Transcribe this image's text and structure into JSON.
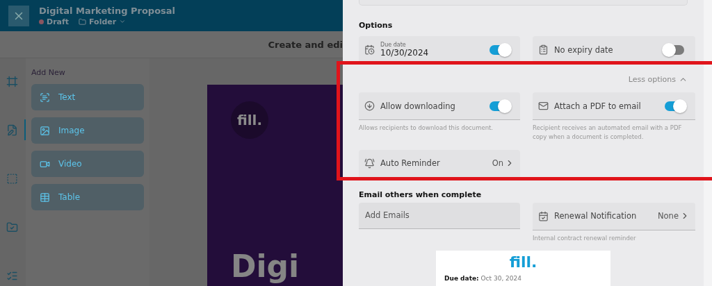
{
  "header": {
    "title": "Digital Marketing Proposal",
    "status": "Draft",
    "folder": "Folder"
  },
  "toolbar_text": "Create and edi",
  "rail": [
    {
      "kind": "frame",
      "selected": false
    },
    {
      "kind": "document",
      "selected": true
    },
    {
      "kind": "dots",
      "selected": false
    },
    {
      "kind": "folder",
      "selected": false
    },
    {
      "kind": "checklist",
      "selected": false
    }
  ],
  "add_new": {
    "title": "Add New",
    "items": [
      {
        "kind": "text",
        "label": "Text"
      },
      {
        "kind": "image",
        "label": "Image"
      },
      {
        "kind": "video",
        "label": "Video"
      },
      {
        "kind": "table",
        "label": "Table"
      }
    ]
  },
  "canvas": {
    "logo": "fill.",
    "headline": "Digi"
  },
  "options": {
    "heading": "Options",
    "cards": [
      {
        "kind": "date",
        "label": "Due date",
        "value": "10/30/2024",
        "on": true
      },
      {
        "kind": "expiry",
        "label": "No expiry date",
        "on": false
      }
    ],
    "less_options": "Less options",
    "advanced": [
      {
        "kind": "download",
        "label": "Allow downloading",
        "on": true,
        "hint": "Allows recipients to download this document."
      },
      {
        "kind": "pdf",
        "label": "Attach a PDF to email",
        "on": true,
        "hint": "Recipient receives an automated email with a PDF copy when a document is completed."
      },
      {
        "kind": "reminder",
        "label": "Auto Reminder",
        "value": "On"
      }
    ]
  },
  "email": {
    "heading": "Email others when complete",
    "placeholder": "Add Emails",
    "renewal": {
      "label": "Renewal Notification",
      "value": "None",
      "hint": "Internal contract renewal reminder"
    }
  },
  "preview": {
    "logo": "fill.",
    "due_label": "Due date:",
    "due_value": "Oct 30, 2024"
  }
}
